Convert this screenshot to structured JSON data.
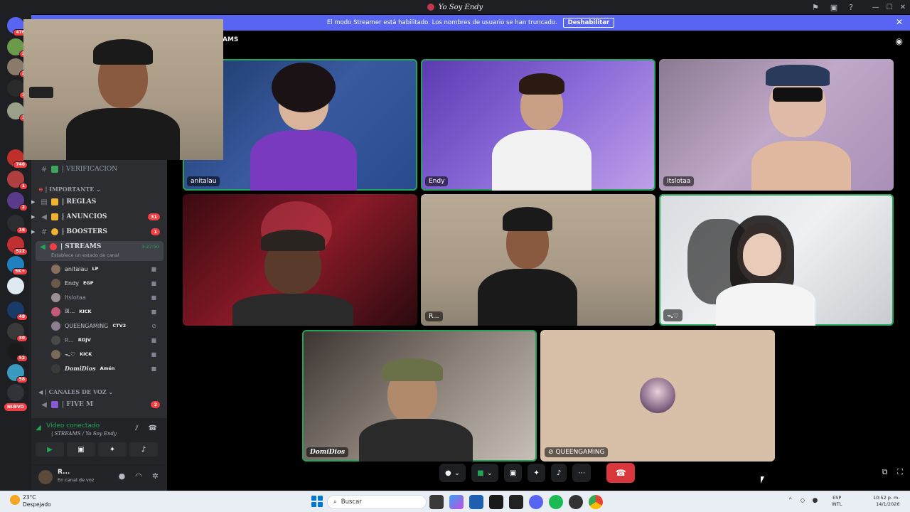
{
  "window": {
    "title": "Yo Soy Endy"
  },
  "banner": {
    "message": "El modo Streamer está habilitado. Los nombres de usuario se han truncado.",
    "disable_label": "Deshabilitar",
    "close": "✕"
  },
  "rail": {
    "badges": [
      "476",
      "2",
      "2",
      "1",
      "1",
      "740",
      "1",
      "2",
      "16",
      "522",
      "5K+",
      "48",
      "30",
      "52",
      "58"
    ],
    "nuevo": "NUEVO"
  },
  "sidebar": {
    "verificacion": "| VERIFICACION",
    "category_importante": "| IMPORTANTE",
    "channels": [
      {
        "name": "| REGLAS",
        "count": ""
      },
      {
        "name": "| ANUNCIOS",
        "count": "31"
      },
      {
        "name": "| BOOSTERS",
        "count": "1"
      }
    ],
    "streams": {
      "name": "| STREAMS",
      "timer": "3:27:50",
      "sub": "Establece un estado de canal"
    },
    "voice_users": [
      {
        "name": "anitalau",
        "tag": "LP",
        "color": "#8a6f5e",
        "cam": "■"
      },
      {
        "name": "Endy",
        "tag": "EGP",
        "color": "#6b5a48",
        "cam": "■"
      },
      {
        "name": "Itslotaa",
        "tag": "",
        "color": "#9a8f96",
        "cam": "■"
      },
      {
        "name": "ꕤ...",
        "tag": "KICK",
        "color": "#c45a7a",
        "cam": "■"
      },
      {
        "name": "QUEENGAMING",
        "tag": "CTV2",
        "color": "#8b7f8f",
        "cam": "⊘"
      },
      {
        "name": "R...",
        "tag": "RDJV",
        "color": "#4a4a4a",
        "cam": "■"
      },
      {
        "name": "ᯓ♡",
        "tag": "KICK",
        "color": "#7a6a5a",
        "cam": "■"
      },
      {
        "name": "DomiDios",
        "tag": "Amén",
        "color": "#3a3a3a",
        "cam": "■"
      }
    ],
    "category_voz": "| CANALES DE VOZ",
    "five_m": {
      "name": "| FIVE M",
      "count": "2"
    }
  },
  "voice_panel": {
    "title": "Vídeo conectado",
    "channel": "| STREAMS / Yo Soy Endy"
  },
  "user_panel": {
    "name": "R...",
    "status": "En canal de voz"
  },
  "main": {
    "header": "AMS",
    "tiles": [
      {
        "name": "anitalau"
      },
      {
        "name": "Endy"
      },
      {
        "name": "Itslotaa"
      },
      {
        "name": ""
      },
      {
        "name": "R..."
      },
      {
        "name": "ᯓ♡"
      },
      {
        "name": "DomiDios"
      },
      {
        "name": "QUEENGAMING"
      }
    ]
  },
  "taskbar": {
    "temp": "23°C",
    "weather": "Despejado",
    "search_placeholder": "Buscar",
    "lang1": "ESP",
    "lang2": "INTL",
    "time": "10:52 p. m.",
    "date": "14/1/2026"
  }
}
